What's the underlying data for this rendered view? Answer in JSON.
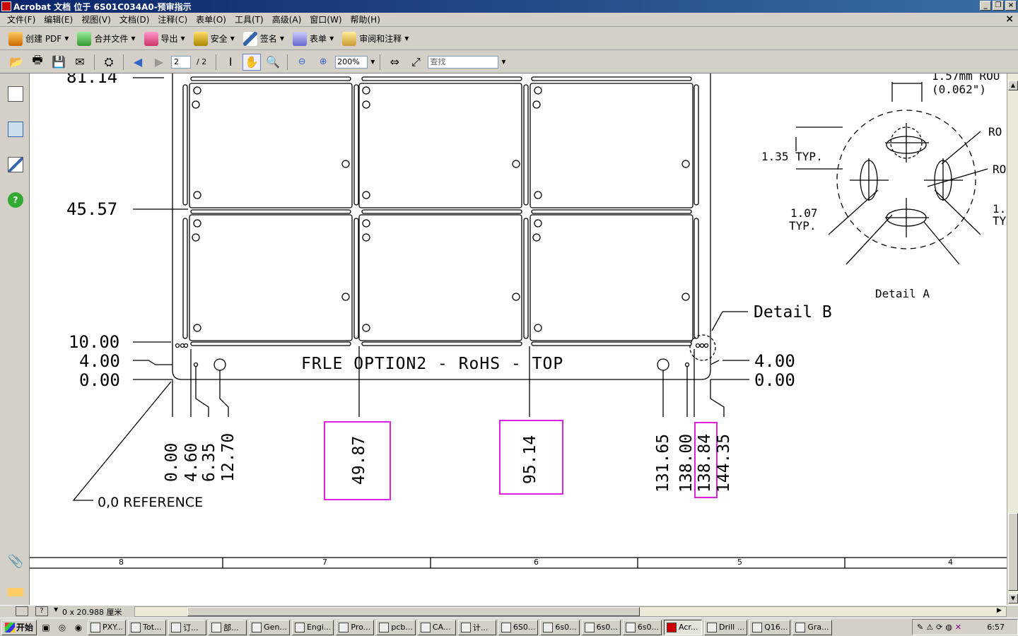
{
  "window": {
    "title": "Acrobat 文档 位于 6S01C034A0-预审指示",
    "controls": [
      "_",
      "❐",
      "×"
    ]
  },
  "menu": [
    "文件(F)",
    "编辑(E)",
    "视图(V)",
    "文档(D)",
    "注释(C)",
    "表单(O)",
    "工具(T)",
    "高级(A)",
    "窗口(W)",
    "帮助(H)"
  ],
  "menu_close": "×",
  "toolbar1": [
    {
      "label": "创建 PDF",
      "icon": "create-pdf-icon"
    },
    {
      "label": "合并文件",
      "icon": "combine-files-icon"
    },
    {
      "label": "导出",
      "icon": "export-icon"
    },
    {
      "label": "安全",
      "icon": "lock-icon"
    },
    {
      "label": "签名",
      "icon": "pen-icon"
    },
    {
      "label": "表单",
      "icon": "form-icon"
    },
    {
      "label": "审阅和注释",
      "icon": "comment-icon"
    }
  ],
  "toolbar2": {
    "page_current": "2",
    "page_total": "/ 2",
    "zoom": "200%",
    "find_placeholder": "查找"
  },
  "drawing": {
    "y_labels_left": [
      "81.14",
      "45.57",
      "10.00",
      "4.00",
      "0.00"
    ],
    "y_labels_right": [
      "4.00",
      "0.00"
    ],
    "x_labels": [
      "0.00",
      "4.60",
      "6.35",
      "12.70",
      "49.87",
      "95.14",
      "131.65",
      "138.00",
      "138.84",
      "144.35"
    ],
    "panel_text": "FRLE OPTION2 - RoHS - TOP",
    "reference_label": "0,0 REFERENCE",
    "detail_b": "Detail B",
    "detail_a": "Detail A",
    "detail_a_notes": [
      "1.57mm ROU",
      "(0.062\")",
      "RO",
      "RO",
      "1.35 TYP.",
      "1.07",
      "TYP.",
      "1.",
      "TY"
    ],
    "zone_numbers": [
      "8",
      "7",
      "6",
      "5",
      "4"
    ],
    "highlight_color": "#e020e0"
  },
  "status": {
    "page_size": "0 x 20.988 厘米"
  },
  "taskbar": {
    "start": "开始",
    "tasks": [
      "PXY...",
      "Tot...",
      "订...",
      "部...",
      "Gen...",
      "Engi...",
      "Pro...",
      "pcb...",
      "CA...",
      "计...",
      "6S0...",
      "6s0...",
      "6s0...",
      "6s0...",
      "Acr...",
      "Drill ...",
      "Q16...",
      "Gra..."
    ],
    "active_task": "Acr...",
    "clock": "6:57"
  }
}
